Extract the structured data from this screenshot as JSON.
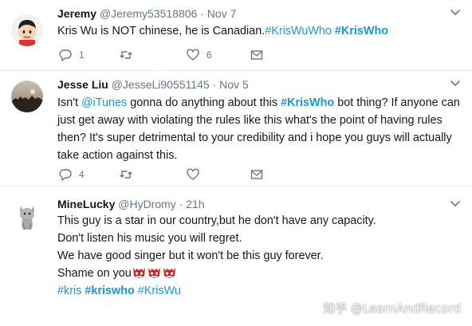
{
  "tweets": [
    {
      "name": "Jeremy",
      "handle": "@Jeremy53518806",
      "dot": "·",
      "time": "Nov 7",
      "text_plain": "Kris Wu is NOT chinese, he is Canadian.",
      "tag1": "#KrisWuWho",
      "tag2": "#KrisWho",
      "replies": "1",
      "retweets": "",
      "likes": "6"
    },
    {
      "name": "Jesse Liu",
      "handle": "@JesseLi90551145",
      "dot": "·",
      "time": "Nov 5",
      "text_a": "Isn't ",
      "mention": "@iTunes",
      "text_b": " gonna do anything about this ",
      "tag": "#KrisWho",
      "text_c": " bot thing? If anyone can just get away with violating the rules like this what's the point of having rules then? It's super detrimental to your credibility and i hope you guys will actually take action against this.",
      "replies": "4",
      "retweets": "",
      "likes": ""
    },
    {
      "name": "MineLucky",
      "handle": "@HyDromy",
      "dot": "·",
      "time": "21h",
      "line1": "This guy is a star in our country,but he don't have any capacity.",
      "line2": "Don't listen his music you will regret.",
      "line3": "We have good singer but it won't be this guy forever.",
      "line4": "Shame on you",
      "tag1": "#kris",
      "tag2": "#kriswho",
      "tag3": "#KrisWu"
    }
  ],
  "watermark": "知乎 @LearnAndRecord",
  "colors": {
    "link": "#1b95e0",
    "muted": "#657786",
    "text": "#14171a",
    "divider": "#e6ecf0"
  }
}
